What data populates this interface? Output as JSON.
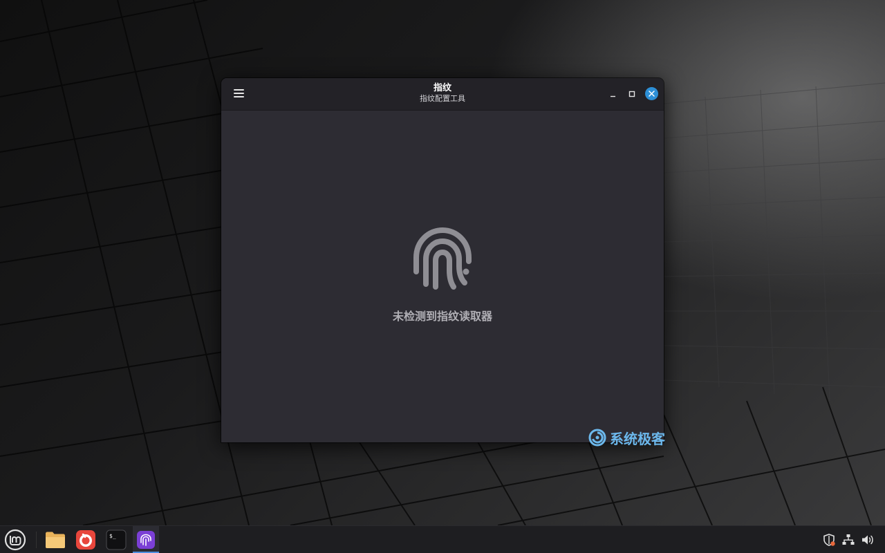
{
  "window": {
    "title": "指纹",
    "subtitle": "指纹配置工具",
    "controls": [
      "minimize-icon",
      "maximize-icon",
      "close-icon"
    ],
    "menu_icon": "hamburger-menu-icon"
  },
  "main": {
    "icon": "fingerprint-icon",
    "message": "未检测到指纹读取器"
  },
  "watermark": {
    "text": "系统极客",
    "color": "#6cb8ec"
  },
  "taskbar": {
    "start_icon": "linux-mint-logo-icon",
    "apps": [
      {
        "name": "files",
        "icon": "folder-icon"
      },
      {
        "name": "firefox",
        "icon": "firefox-icon"
      },
      {
        "name": "terminal",
        "icon": "terminal-icon"
      },
      {
        "name": "fingerprint",
        "icon": "fingerprint-app-icon",
        "active": true
      }
    ],
    "tray": [
      "shield-update-icon",
      "network-icon",
      "volume-icon"
    ]
  },
  "colors": {
    "accent": "#2d8fd6",
    "window_bg": "#2d2c33",
    "header_bg": "#232227",
    "message_text": "#b0afb5",
    "fingerprint_app": "#7b3fd6"
  }
}
